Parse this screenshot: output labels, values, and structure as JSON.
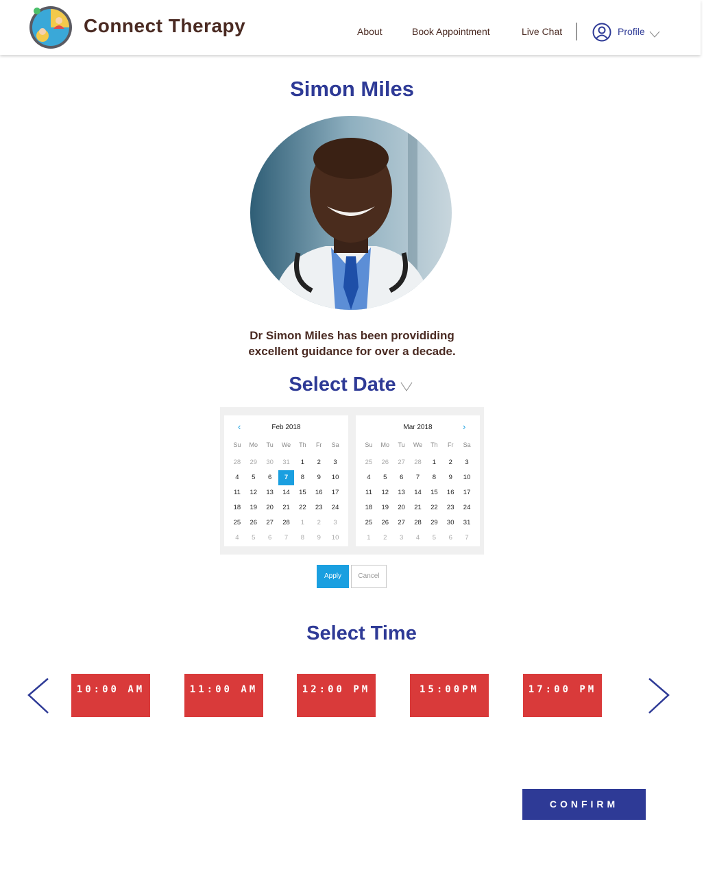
{
  "header": {
    "brand": "Connect Therapy",
    "nav": {
      "about": "About",
      "book": "Book Appointment",
      "chat": "Live Chat"
    },
    "profile": "Profile"
  },
  "doctor": {
    "name": "Simon Miles",
    "bio_line1": "Dr Simon Miles has been provididing",
    "bio_line2": "excellent guidance for over a decade."
  },
  "date_section": {
    "title": "Select Date",
    "weekdays": [
      "Su",
      "Mo",
      "Tu",
      "We",
      "Th",
      "Fr",
      "Sa"
    ],
    "months": [
      {
        "title": "Feb 2018",
        "days": [
          [
            "28",
            "29",
            "30",
            "31",
            "1",
            "2",
            "3"
          ],
          [
            "4",
            "5",
            "6",
            "7",
            "8",
            "9",
            "10"
          ],
          [
            "11",
            "12",
            "13",
            "14",
            "15",
            "16",
            "17"
          ],
          [
            "18",
            "19",
            "20",
            "21",
            "22",
            "23",
            "24"
          ],
          [
            "25",
            "26",
            "27",
            "28",
            "1",
            "2",
            "3"
          ],
          [
            "4",
            "5",
            "6",
            "7",
            "8",
            "9",
            "10"
          ]
        ],
        "muted": [
          [
            0,
            0
          ],
          [
            0,
            1
          ],
          [
            0,
            2
          ],
          [
            0,
            3
          ],
          [
            4,
            4
          ],
          [
            4,
            5
          ],
          [
            4,
            6
          ],
          [
            5,
            0
          ],
          [
            5,
            1
          ],
          [
            5,
            2
          ],
          [
            5,
            3
          ],
          [
            5,
            4
          ],
          [
            5,
            5
          ],
          [
            5,
            6
          ]
        ],
        "selected": [
          1,
          3
        ]
      },
      {
        "title": "Mar 2018",
        "days": [
          [
            "25",
            "26",
            "27",
            "28",
            "1",
            "2",
            "3"
          ],
          [
            "4",
            "5",
            "6",
            "7",
            "8",
            "9",
            "10"
          ],
          [
            "11",
            "12",
            "13",
            "14",
            "15",
            "16",
            "17"
          ],
          [
            "18",
            "19",
            "20",
            "21",
            "22",
            "23",
            "24"
          ],
          [
            "25",
            "26",
            "27",
            "28",
            "29",
            "30",
            "31"
          ],
          [
            "1",
            "2",
            "3",
            "4",
            "5",
            "6",
            "7"
          ]
        ],
        "muted": [
          [
            0,
            0
          ],
          [
            0,
            1
          ],
          [
            0,
            2
          ],
          [
            0,
            3
          ],
          [
            5,
            0
          ],
          [
            5,
            1
          ],
          [
            5,
            2
          ],
          [
            5,
            3
          ],
          [
            5,
            4
          ],
          [
            5,
            5
          ],
          [
            5,
            6
          ]
        ],
        "selected": null
      }
    ],
    "apply": "Apply",
    "cancel": "Cancel",
    "selected_color": "#1a9fe0"
  },
  "time_section": {
    "title": "Select Time",
    "slots": [
      "10:00 AM",
      "11:00 AM",
      "12:00 PM",
      "15:00PM",
      "17:00 PM"
    ],
    "slot_color": "#d93a3a"
  },
  "confirm": "CONFIRM",
  "colors": {
    "brand_blue": "#2e3a96",
    "brown_text": "#4a2a22"
  }
}
